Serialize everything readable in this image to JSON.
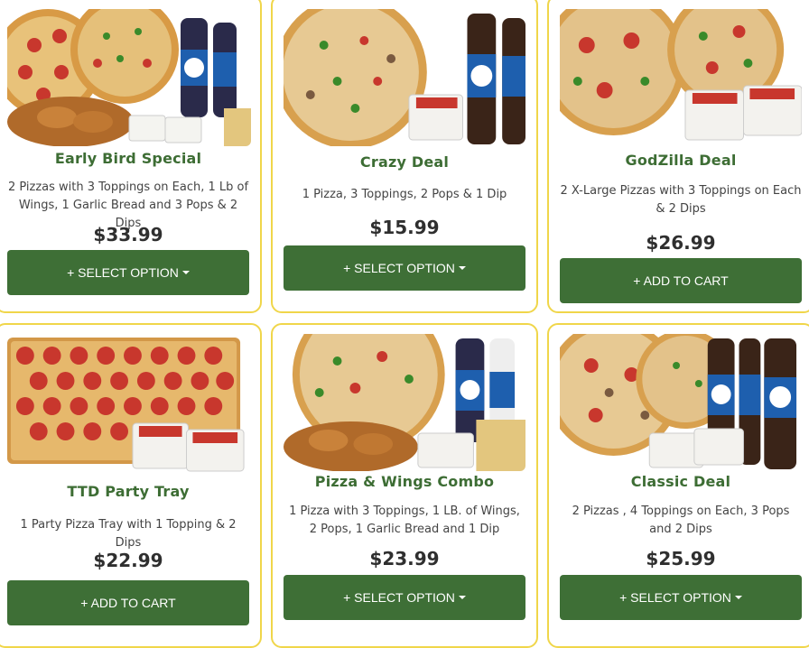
{
  "deals": [
    {
      "title": "Early Bird Special",
      "desc": "2 Pizzas with 3 Toppings on Each, 1 Lb of Wings, 1 Garlic Bread and 3 Pops & 2 Dips",
      "price": "$33.99",
      "button": "+ SELECT OPTION",
      "has_caret": true,
      "image": "pizzas-wings-pepsi-image"
    },
    {
      "title": "Crazy Deal",
      "desc": "1 Pizza, 3 Toppings, 2 Pops & 1 Dip",
      "price": "$15.99",
      "button": "+ SELECT OPTION",
      "has_caret": true,
      "image": "pizza-pepsi-dip-image"
    },
    {
      "title": "GodZilla Deal",
      "desc": "2 X-Large Pizzas with 3 Toppings on Each & 2 Dips",
      "price": "$26.99",
      "button": "+ ADD TO CART",
      "has_caret": false,
      "image": "two-pizzas-dips-image"
    },
    {
      "title": "TTD Party Tray",
      "desc": "1 Party Pizza Tray with 1 Topping & 2 Dips",
      "price": "$22.99",
      "button": "+ ADD TO CART",
      "has_caret": false,
      "image": "party-tray-image"
    },
    {
      "title": "Pizza & Wings Combo",
      "desc": "1 Pizza with 3 Toppings, 1 LB. of Wings, 2 Pops, 1 Garlic Bread and 1 Dip",
      "price": "$23.99",
      "button": "+ SELECT OPTION",
      "has_caret": true,
      "image": "pizza-wings-pepsi-image"
    },
    {
      "title": "Classic Deal",
      "desc": "2 Pizzas , 4 Toppings on Each, 3 Pops and 2 Dips",
      "price": "$25.99",
      "button": "+ SELECT OPTION",
      "has_caret": true,
      "image": "pizzas-pepsi-dips-image"
    }
  ],
  "colors": {
    "button": "#3e6f36",
    "title": "#3d6d34",
    "border": "#f0d64a"
  }
}
